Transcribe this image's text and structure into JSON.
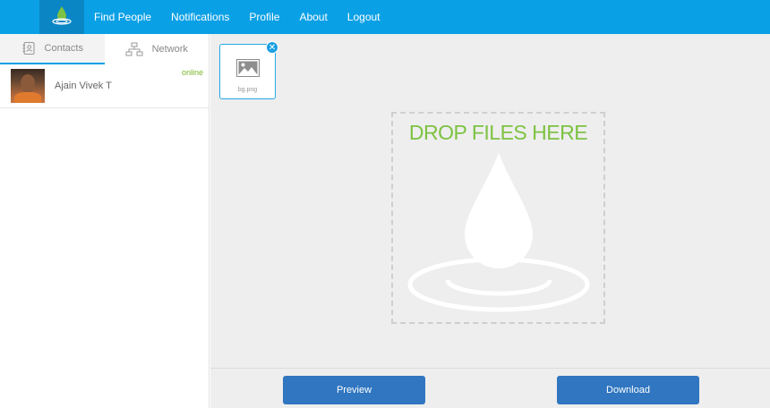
{
  "nav": {
    "logo_icon": "droplet-logo-icon",
    "items": [
      "Find People",
      "Notifications",
      "Profile",
      "About",
      "Logout"
    ]
  },
  "sidebar": {
    "tabs": [
      {
        "label": "Contacts",
        "icon": "contacts-book-icon",
        "active": true
      },
      {
        "label": "Network",
        "icon": "network-icon",
        "active": false
      }
    ],
    "contacts": [
      {
        "name": "Ajain Vivek T",
        "status": "online"
      }
    ]
  },
  "main": {
    "files": [
      {
        "name": "bg.png",
        "icon": "image-icon"
      }
    ],
    "dropzone": {
      "text": "DROP FILES HERE",
      "icon": "droplet-ripple-icon"
    }
  },
  "footer": {
    "preview_label": "Preview",
    "download_label": "Download"
  },
  "colors": {
    "brand": "#0aa0e6",
    "accent_green": "#7dc242",
    "button": "#3076c0"
  }
}
